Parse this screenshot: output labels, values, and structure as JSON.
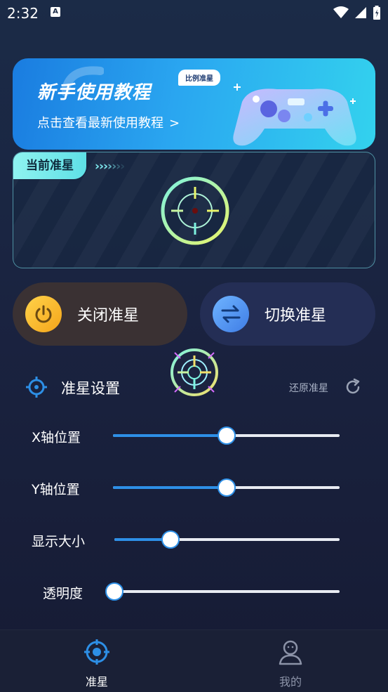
{
  "status_bar": {
    "time": "2:32",
    "notification_glyph": "A"
  },
  "banner": {
    "title": "新手使用教程",
    "badge": "比例准星",
    "subtitle": "点击查看最新使用教程",
    "arrow": ">"
  },
  "current_crosshair": {
    "tab_label": "当前准星",
    "chevrons": [
      "›",
      "›",
      "›",
      "›",
      "›",
      "›",
      "›"
    ]
  },
  "actions": {
    "close_label": "关闭准星",
    "switch_label": "切换准星"
  },
  "settings": {
    "title": "准星设置",
    "reset_label": "还原准星",
    "sliders": [
      {
        "label": "X轴位置",
        "value": 0.5
      },
      {
        "label": "Y轴位置",
        "value": 0.5
      },
      {
        "label": "显示大小",
        "value": 0.25
      },
      {
        "label": "透明度",
        "value": 0.0
      }
    ]
  },
  "bottom_nav": {
    "items": [
      {
        "label": "准星",
        "icon": "crosshair-icon",
        "active": true
      },
      {
        "label": "我的",
        "icon": "profile-icon",
        "active": false
      }
    ]
  },
  "colors": {
    "accent": "#2d8fe6",
    "banner_start": "#1a7ce0",
    "banner_end": "#33d2ee",
    "close_button_bg": "#3a3133",
    "switch_button_bg": "#242e55",
    "power_icon": "#f4a51a"
  }
}
